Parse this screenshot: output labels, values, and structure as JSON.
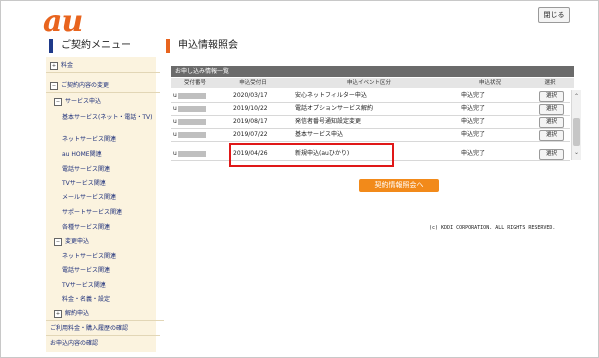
{
  "brand": {
    "logo_text": "au",
    "logo_color": "#e8641e"
  },
  "header": {
    "close_label": "閉じる"
  },
  "sidebar": {
    "title": "ご契約メニュー",
    "items": [
      {
        "label": "料金",
        "box": "+"
      },
      {
        "label": "ご契約内容の変更",
        "box": "−"
      },
      {
        "label": "サービス申込",
        "box": "−"
      },
      {
        "label": "基本サービス(ネット・電話・TV)"
      },
      {
        "label": "ネットサービス関連"
      },
      {
        "label": "au HOME関連"
      },
      {
        "label": "電話サービス関連"
      },
      {
        "label": "TVサービス関連"
      },
      {
        "label": "メールサービス関連"
      },
      {
        "label": "サポートサービス関連"
      },
      {
        "label": "各種サービス関連"
      },
      {
        "label": "変更申込",
        "box": "−"
      },
      {
        "label": "ネットサービス関連"
      },
      {
        "label": "電話サービス関連"
      },
      {
        "label": "TVサービス関連"
      },
      {
        "label": "料金・名義・設定"
      },
      {
        "label": "解約申込",
        "box": "+"
      },
      {
        "label": "ご利用料金・購入履歴の確認"
      },
      {
        "label": "お申込内容の確認"
      }
    ]
  },
  "main": {
    "title": "申込情報照会",
    "section_title": "お申し込み情報一覧",
    "columns": [
      "受付番号",
      "申込受付日",
      "申込イベント区分",
      "申込状況",
      "選択"
    ],
    "rows": [
      {
        "id_prefix": "u",
        "date": "2020/03/17",
        "event": "安心ネットフィルター申込",
        "status": "申込完了",
        "select": "選択"
      },
      {
        "id_prefix": "u",
        "date": "2019/10/22",
        "event": "電話オプションサービス解約",
        "status": "申込完了",
        "select": "選択"
      },
      {
        "id_prefix": "u",
        "date": "2019/08/17",
        "event": "発信者番号通知設定変更",
        "status": "申込完了",
        "select": "選択"
      },
      {
        "id_prefix": "u",
        "date": "2019/07/22",
        "event": "基本サービス申込",
        "status": "申込完了",
        "select": "選択"
      },
      {
        "id_prefix": "u",
        "date": "2019/04/26",
        "event": "新規申込(auひかり)",
        "status": "申込完了",
        "select": "選択"
      }
    ],
    "action_button": "契約情報照会へ",
    "copyright": "(c) KDDI CORPORATION. ALL RIGHTS RESERVED."
  },
  "icons": {
    "scroll_up": "chevron-up-icon",
    "scroll_down": "chevron-down-icon"
  }
}
